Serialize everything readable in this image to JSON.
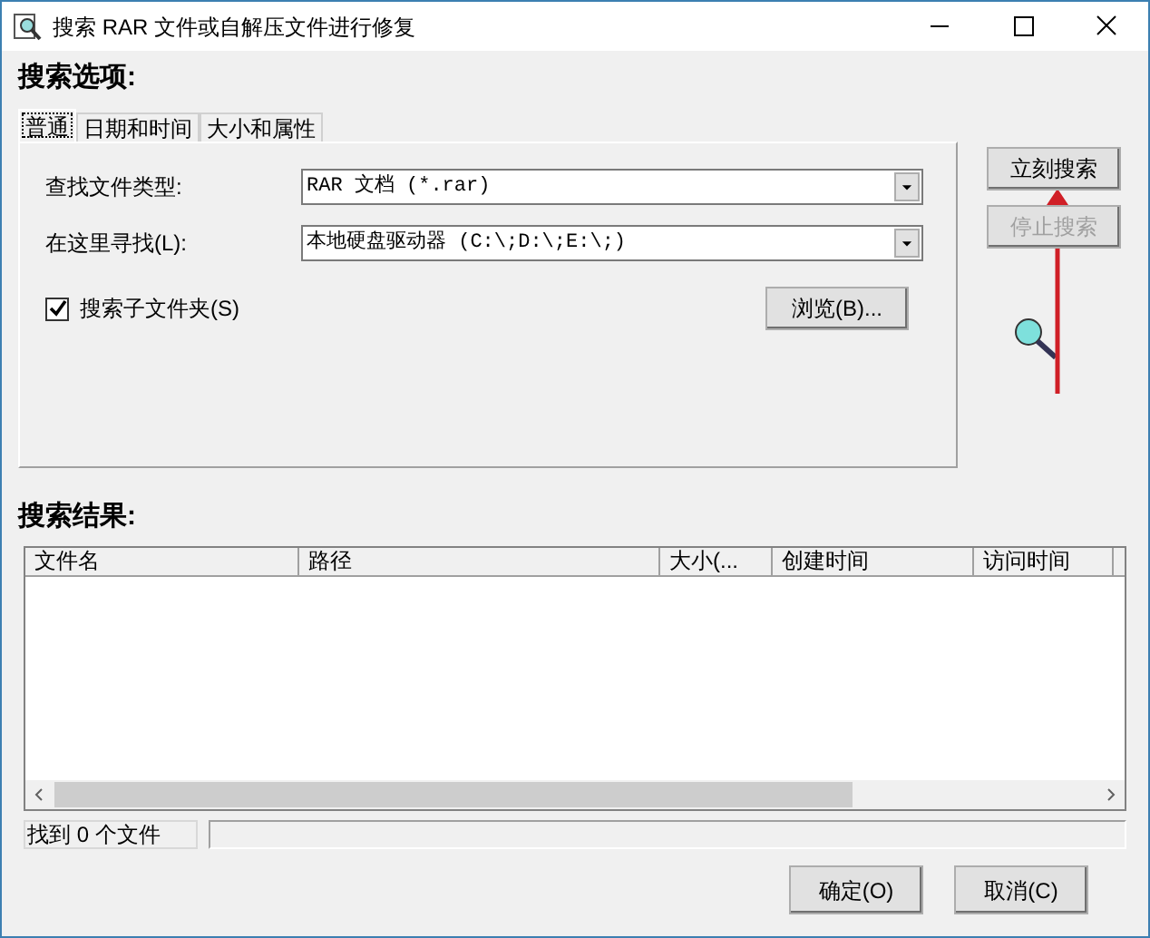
{
  "window": {
    "title": "搜索 RAR 文件或自解压文件进行修复"
  },
  "options": {
    "heading": "搜索选项:",
    "tabs": [
      {
        "label": "普通",
        "selected": true
      },
      {
        "label": "日期和时间",
        "selected": false
      },
      {
        "label": "大小和属性",
        "selected": false
      }
    ],
    "fields": [
      {
        "label": "查找文件类型:",
        "value": "RAR 文档 (*.rar)"
      },
      {
        "label": "在这里寻找(L):",
        "value": "本地硬盘驱动器 (C:\\;D:\\;E:\\;)"
      }
    ],
    "subfolders": {
      "label": "搜索子文件夹(S)",
      "checked": true
    },
    "browse": "浏览(B)..."
  },
  "actions": [
    {
      "label": "立刻搜索",
      "disabled": false
    },
    {
      "label": "停止搜索",
      "disabled": true
    }
  ],
  "results": {
    "heading": "搜索结果:",
    "columns": [
      "文件名",
      "路径",
      "大小(...",
      "创建时间",
      "访问时间"
    ]
  },
  "status_bar": {
    "found": "找到 0 个文件"
  },
  "buttons": [
    "确定(O)",
    "取消(C)"
  ]
}
